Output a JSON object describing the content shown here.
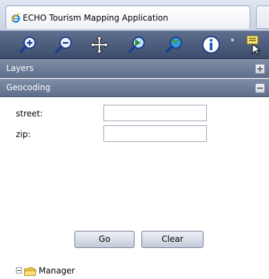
{
  "browser": {
    "tab_title": "ECHO Tourism Mapping Application",
    "tab_icon": "internet-explorer-icon"
  },
  "toolbar": {
    "tools": [
      {
        "name": "zoom-in-icon"
      },
      {
        "name": "zoom-out-icon"
      },
      {
        "name": "pan-icon"
      },
      {
        "name": "zoom-previous-icon"
      },
      {
        "name": "zoom-full-extent-icon"
      },
      {
        "name": "identify-info-icon"
      },
      {
        "name": "select-features-icon"
      }
    ]
  },
  "panels": {
    "layers": {
      "title": "Layers",
      "state": "collapsed"
    },
    "geocoding": {
      "title": "Geocoding",
      "state": "expanded"
    }
  },
  "geocoding": {
    "street_label": "street:",
    "street_value": "",
    "zip_label": "zip:",
    "zip_value": "",
    "go_label": "Go",
    "clear_label": "Clear"
  },
  "tree": {
    "root_label": "Manager",
    "expanded": true
  },
  "colors": {
    "toolbar": "#4a5b7b",
    "panel_header": "#6f7e99",
    "button_border": "#6f7c93"
  }
}
